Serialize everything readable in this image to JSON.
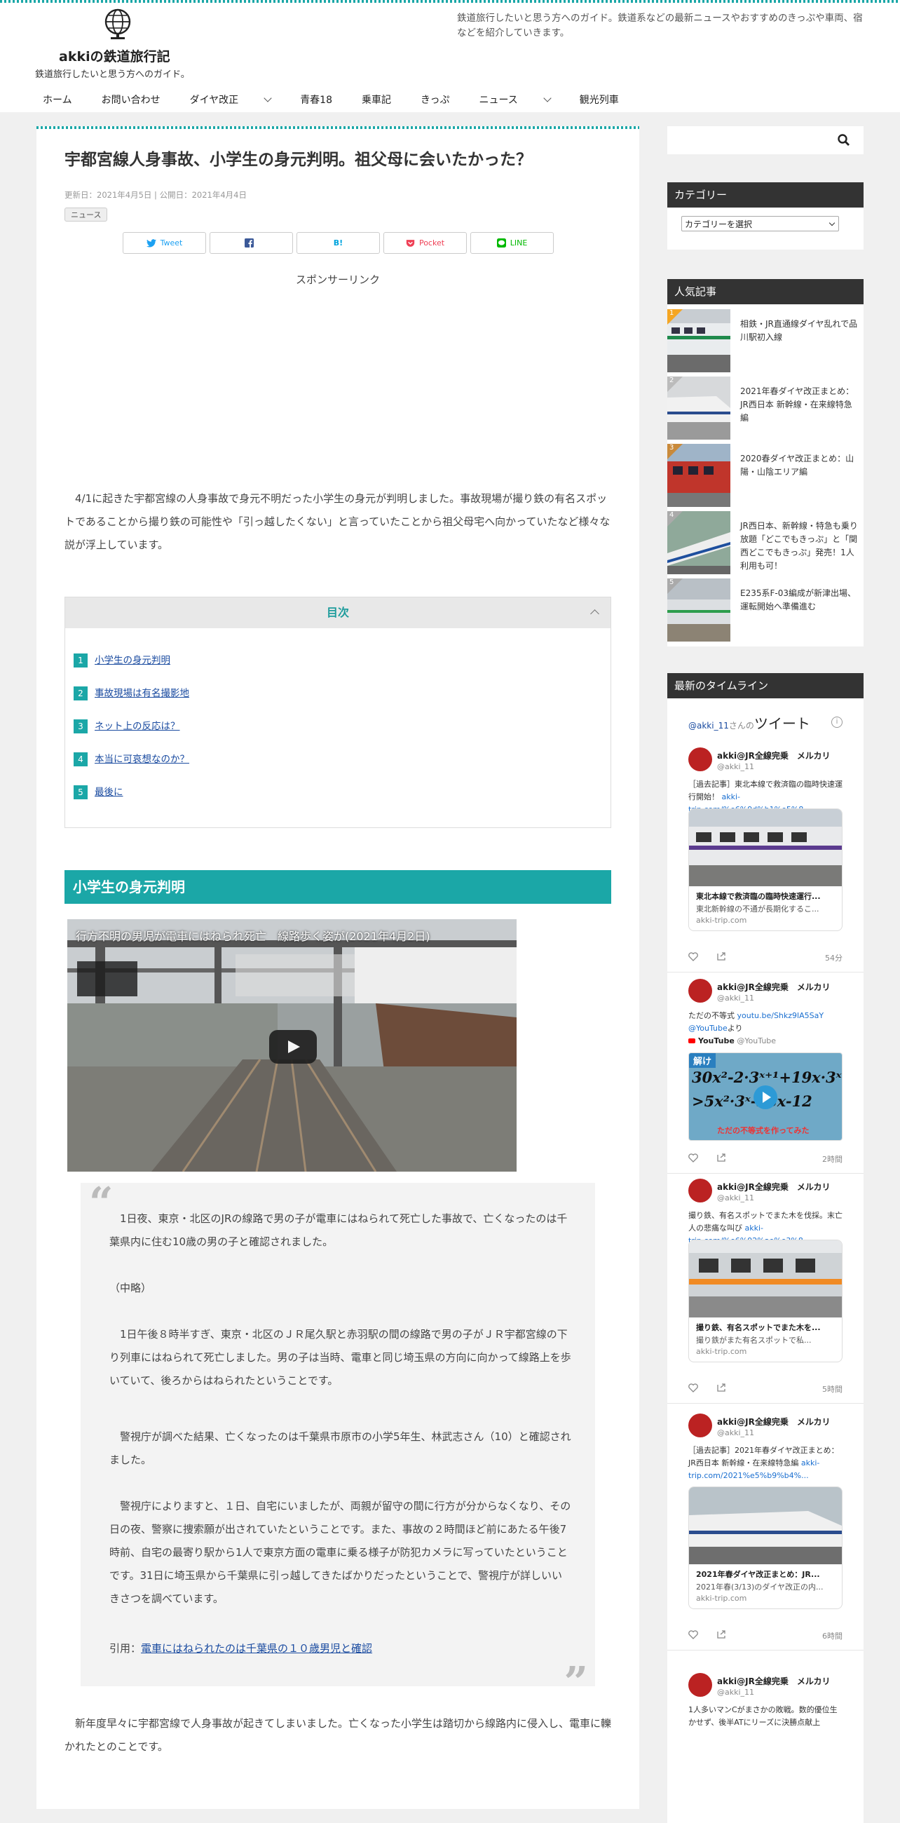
{
  "header": {
    "site_title": "akkiの鉄道旅行記",
    "site_tagline": "鉄道旅行したいと思う方へのガイド。",
    "site_description": "鉄道旅行したいと思う方へのガイド。鉄道系などの最新ニュースやおすすめのきっぷや車両、宿などを紹介していきます。",
    "nav": [
      "ホーム",
      "お問い合わせ",
      "ダイヤ改正",
      "青春18",
      "乗車記",
      "きっぷ",
      "ニュース",
      "観光列車"
    ]
  },
  "post": {
    "title": "宇都宮線人身事故、小学生の身元判明。祖父母に会いたかった？",
    "dates": "更新日：2021年4月5日 | 公開日：2021年4月4日",
    "category": "ニュース",
    "share": [
      "Tweet",
      "",
      "B!",
      "Pocket",
      "LINE"
    ],
    "sponsor": "スポンサーリンク",
    "intro": "4/1に起きた宇都宮線の人身事故で身元不明だった小学生の身元が判明しました。事故現場が撮り鉄の有名スポットであることから撮り鉄の可能性や「引っ越したくない」と言っていたことから祖父母宅へ向かっていたなど様々な説が浮上しています。",
    "toc_title": "目次",
    "toc": [
      {
        "num": "1",
        "label": "小学生の身元判明"
      },
      {
        "num": "2",
        "label": "事故現場は有名撮影地"
      },
      {
        "num": "3",
        "label": "ネット上の反応は？"
      },
      {
        "num": "4",
        "label": "本当に可哀想なのか？"
      },
      {
        "num": "5",
        "label": "最後に"
      }
    ],
    "h2": "小学生の身元判明",
    "video_title": "行方不明の男児が電車にはねられ死亡　線路歩く姿が(2021年4月2日)",
    "quote": {
      "p1": "1日夜、東京・北区のJRの線路で男の子が電車にはねられて死亡した事故で、亡くなったのは千葉県内に住む10歳の男の子と確認されました。",
      "p2": "（中略）",
      "p3": "1日午後８時半すぎ、東京・北区のＪＲ尾久駅と赤羽駅の間の線路で男の子がＪＲ宇都宮線の下り列車にはねられて死亡しました。男の子は当時、電車と同じ埼玉県の方向に向かって線路上を歩いていて、後ろからはねられたということです。",
      "p4": "警視庁が調べた結果、亡くなったのは千葉県市原市の小学5年生、林武志さん（10）と確認されました。",
      "p5": "警視庁によりますと、１日、自宅にいましたが、両親が留守の間に行方が分からなくなり、その日の夜、警察に捜索願が出されていたということです。また、事故の２時間ほど前にあたる午後7時前、自宅の最寄り駅から1人で東京方面の電車に乗る様子が防犯カメラに写っていたということです。31日に埼玉県から千葉県に引っ越してきたばかりだったということで、警視庁が詳しいいきさつを調べています。",
      "cite_prefix": "引用：",
      "cite_link": "電車にはねられたのは千葉県の１０歳男児と確認"
    },
    "after": "新年度早々に宇都宮線で人身事故が起きてしまいました。亡くなった小学生は踏切から線路内に侵入し、電車に轢かれたとのことです。"
  },
  "sidebar": {
    "category_title": "カテゴリー",
    "category_select": "カテゴリーを選択",
    "popular_title": "人気記事",
    "popular": [
      {
        "rank": "1",
        "title": "相鉄・JR直通線ダイヤ乱れで品川駅初入線"
      },
      {
        "rank": "2",
        "title": "2021年春ダイヤ改正まとめ：JR西日本 新幹線・在来線特急編"
      },
      {
        "rank": "3",
        "title": "2020春ダイヤ改正まとめ：山陽・山陰エリア編"
      },
      {
        "rank": "4",
        "title": "JR西日本、新幹線・特急も乗り放題「どこでもきっぷ」と「関西どこでもきっぷ」発売！1人利用も可！"
      },
      {
        "rank": "5",
        "title": "E235系F-03編成が新津出場、運転開始へ準備進む"
      }
    ],
    "timeline_title": "最新のタイムライン",
    "timeline": {
      "handle_link": "@akki_11",
      "handle_suffix": "さんの",
      "tweets_word": "ツイート",
      "tweets": [
        {
          "name": "akki@JR全線完乗　メルカリ",
          "handle": "@akki_11",
          "text": "［過去記事］東北本線で救済臨の臨時快速運行開始！",
          "link": "akki-trip.com/%e6%9d%b1%e5%8...",
          "card_title": "東北本線で救済臨の臨時快速運行...",
          "card_desc": "東北新幹線の不通が長期化するこ...",
          "card_domain": "akki-trip.com",
          "time": "54分"
        },
        {
          "name": "akki@JR全線完乗　メルカリ",
          "handle": "@akki_11",
          "text": "ただの不等式",
          "link": "youtu.be/Shkz9lA5SaY",
          "link2": "@YouTube",
          "text2": "より",
          "yt_label": "YouTube",
          "yt_handle": "@YouTube",
          "yt_banner": "解け",
          "yt_math1": "30x²-2·3ˣ⁺¹+19x·3ˣ",
          "yt_math2": ">5x²·3ˣ-38x-12",
          "yt_sub": "ただの不等式を作ってみた",
          "time": "2時間"
        },
        {
          "name": "akki@JR全線完乗　メルカリ",
          "handle": "@akki_11",
          "text": "撮り鉄、有名スポットでまた木を伐採。末亡人の悲痛な叫び",
          "link": "akki-trip.com/%e6%92%ae%e3%8...",
          "card_title": "撮り鉄、有名スポットでまた木を...",
          "card_desc": "撮り鉄がまた有名スポットで私...",
          "card_domain": "akki-trip.com",
          "time": "5時間"
        },
        {
          "name": "akki@JR全線完乗　メルカリ",
          "handle": "@akki_11",
          "text": "［過去記事］2021年春ダイヤ改正まとめ：JR西日本 新幹線・在来線特急編",
          "link": "akki-trip.com/2021%e5%b9%b4%...",
          "card_title": "2021年春ダイヤ改正まとめ：JR...",
          "card_desc": "2021年春(3/13)のダイヤ改正の内...",
          "card_domain": "akki-trip.com",
          "time": "6時間"
        },
        {
          "name": "akki@JR全線完乗　メルカリ",
          "handle": "@akki_11",
          "text": "1人多いマンCがまさかの敗戦。数的優位生かせず、後半ATにリーズに決勝点献上"
        }
      ]
    }
  }
}
